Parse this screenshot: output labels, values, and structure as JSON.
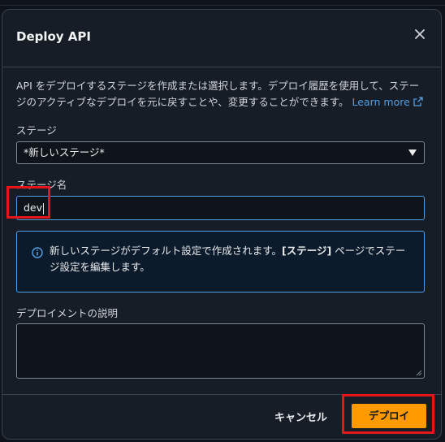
{
  "modal": {
    "title": "Deploy API",
    "description": "API をデプロイするステージを作成または選択します。デプロイ履歴を使用して、ステージのアクティブなデプロイを元に戻すことや、変更することができます。",
    "learn_more": "Learn more"
  },
  "stage": {
    "label": "ステージ",
    "selected": "*新しいステージ*"
  },
  "stage_name": {
    "label": "ステージ名",
    "value": "dev"
  },
  "info": {
    "text_before": "新しいステージがデフォルト設定で作成されます。",
    "text_bold": "[ステージ]",
    "text_after": " ページでステージ設定を編集します。"
  },
  "deployment_description": {
    "label": "デプロイメントの説明",
    "value": ""
  },
  "footer": {
    "cancel_label": "キャンセル",
    "deploy_label": "デプロイ"
  },
  "colors": {
    "accent": "#ff9900",
    "link": "#539fe5",
    "highlight": "#e5161b"
  }
}
